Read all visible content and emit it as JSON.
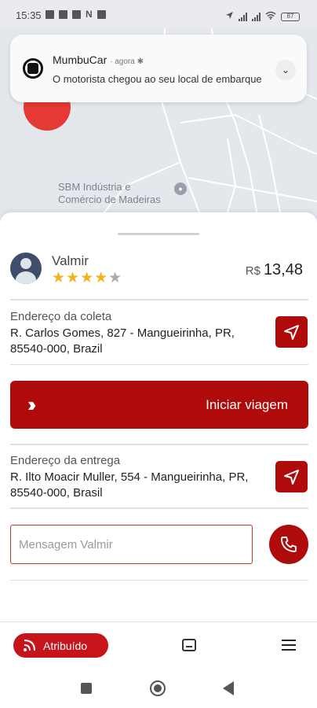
{
  "status_bar": {
    "time": "15:35",
    "battery": "87"
  },
  "notification": {
    "app_name": "MumbuCar",
    "time": "agora",
    "message": "O motorista chegou ao seu local de embarque"
  },
  "map": {
    "poi_line1": "SBM Indústria e",
    "poi_line2": "Comércio de Madeiras"
  },
  "driver": {
    "name": "Valmir",
    "rating": 4,
    "rating_max": 5,
    "stars_on": "★★★★",
    "stars_off": "★"
  },
  "fare": {
    "currency": "R$",
    "amount": "13,48"
  },
  "pickup": {
    "label": "Endereço da coleta",
    "address": "R. Carlos Gomes, 827 - Mangueirinha, PR, 85540-000, Brazil"
  },
  "start_button": {
    "label": "Iniciar viagem"
  },
  "dropoff": {
    "label": "Endereço da entrega",
    "address": "R. Ilto Moacir Muller, 554 - Mangueirinha, PR, 85540-000, Brasil"
  },
  "message": {
    "placeholder": "Mensagem Valmir"
  },
  "bottom_nav": {
    "assigned_label": "Atribuído"
  },
  "colors": {
    "brand_red": "#b00b0b",
    "pill_red": "#c7141a",
    "star": "#f5b21f"
  }
}
